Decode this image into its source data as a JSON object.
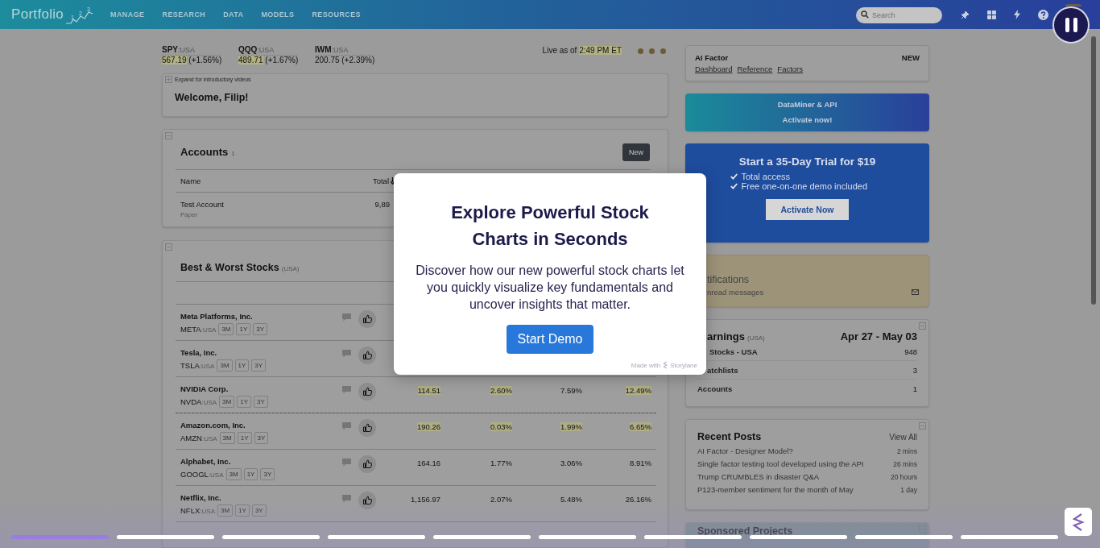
{
  "header": {
    "logo": "Portfolio",
    "logo_steps": [
      "1",
      "2",
      "3"
    ],
    "nav": [
      "MANAGE",
      "RESEARCH",
      "DATA",
      "MODELS",
      "RESOURCES"
    ],
    "search": {
      "placeholder": "Search"
    }
  },
  "market": {
    "tickers": [
      {
        "symbol": "SPY",
        "exchange": ":USA",
        "price": "567.19",
        "change": "(+1.56%)",
        "highlighted": true
      },
      {
        "symbol": "QQQ",
        "exchange": ":USA",
        "price": "489.71",
        "change": "(+1.67%)",
        "highlighted": true
      },
      {
        "symbol": "IWM",
        "exchange": ":USA",
        "price": "200.75",
        "change": "(+2.39%)",
        "highlighted": false
      }
    ],
    "live_label": "Live as of",
    "live_time": "2:49 PM ET"
  },
  "welcome": {
    "expand_label": "Expand for introductory videos",
    "greeting": "Welcome, Filip!"
  },
  "accounts": {
    "title": "Accounts",
    "count": "1",
    "new_button": "New",
    "columns": [
      "Name",
      "Total"
    ],
    "rows": [
      {
        "name": "Test Account",
        "type": "Paper",
        "total": "9,89"
      }
    ]
  },
  "stocks": {
    "title": "Best & Worst Stocks",
    "region": "(USA)",
    "rows": [
      {
        "name": "Meta Platforms, Inc.",
        "ticker": "META",
        "exchange": ":USA",
        "periods": [
          "3M",
          "1Y",
          "3Y"
        ],
        "values": [],
        "dashed_divider_above": false
      },
      {
        "name": "Tesla, Inc.",
        "ticker": "TSLA",
        "exchange": ":USA",
        "periods": [
          "3M",
          "1Y",
          "3Y"
        ],
        "values": [],
        "dashed_divider_above": false
      },
      {
        "name": "NVIDIA Corp.",
        "ticker": "NVDA",
        "exchange": ":USA",
        "periods": [
          "3M",
          "1Y",
          "3Y"
        ],
        "values": [
          {
            "text": "114.51",
            "highlighted": true
          },
          {
            "text": "2.60%",
            "highlighted": true
          },
          {
            "text": "7.59%",
            "highlighted": false
          },
          {
            "text": "12.49%",
            "highlighted": true
          }
        ],
        "dashed_divider_above": false
      },
      {
        "name": "Amazon.com, Inc.",
        "ticker": "AMZN",
        "exchange": ":USA",
        "periods": [
          "3M",
          "1Y",
          "3Y"
        ],
        "values": [
          {
            "text": "190.26",
            "highlighted": true
          },
          {
            "text": "0.03%",
            "highlighted": true
          },
          {
            "text": "1.99%",
            "highlighted": true
          },
          {
            "text": "6.65%",
            "highlighted": true
          }
        ],
        "dashed_divider_above": true
      },
      {
        "name": "Alphabet, Inc.",
        "ticker": "GOOGL",
        "exchange": ":USA",
        "periods": [
          "3M",
          "1Y",
          "3Y"
        ],
        "values": [
          {
            "text": "164.16",
            "highlighted": false
          },
          {
            "text": "1.77%",
            "highlighted": false
          },
          {
            "text": "3.06%",
            "highlighted": false
          },
          {
            "text": "8.91%",
            "highlighted": false
          }
        ],
        "dashed_divider_above": false
      },
      {
        "name": "Netflix, Inc.",
        "ticker": "NFLX",
        "exchange": ":USA",
        "periods": [
          "3M",
          "1Y",
          "3Y"
        ],
        "values": [
          {
            "text": "1,156.97",
            "highlighted": false
          },
          {
            "text": "2.07%",
            "highlighted": false
          },
          {
            "text": "5.48%",
            "highlighted": false
          },
          {
            "text": "26.16%",
            "highlighted": false
          }
        ],
        "dashed_divider_above": false
      }
    ]
  },
  "ai_factor": {
    "title": "AI Factor",
    "badge": "NEW",
    "links": [
      "Dashboard",
      "Reference",
      "Factors"
    ]
  },
  "dataminer": {
    "title": "DataMiner & API",
    "action": "Activate now!"
  },
  "trial": {
    "title": "Start a 35-Day Trial for $19",
    "features": [
      "Total access",
      "Free one-on-one demo included"
    ],
    "button": "Activate Now"
  },
  "notifications": {
    "title": "tifications",
    "subtitle": "nread messages"
  },
  "earnings": {
    "title": "arnings",
    "region": "(USA)",
    "range": "Apr 27 - May 03",
    "rows": [
      {
        "label": "Stocks - USA",
        "count": "948"
      },
      {
        "label": "atchlists",
        "count": "3"
      },
      {
        "label": "Accounts",
        "count": "1"
      }
    ]
  },
  "recent_posts": {
    "title": "Recent Posts",
    "view_all": "View All",
    "posts": [
      {
        "title": "AI Factor - Designer Model?",
        "age": "2 mins"
      },
      {
        "title": "Single factor testing tool developed using the API",
        "age": "26 mins"
      },
      {
        "title": "Trump CRUMBLES in disaster Q&A",
        "age": "20 hours"
      },
      {
        "title": "P123-member sentiment for the month of May",
        "age": "1 day"
      }
    ]
  },
  "sponsored": {
    "title": "Sponsored Projects"
  },
  "modal": {
    "title": "Explore Powerful Stock Charts in Seconds",
    "body": "Discover how our new powerful stock charts let you quickly visualize key fundamentals and uncover insights that matter.",
    "button": "Start Demo",
    "credit": "Made with",
    "brand": "Storylane"
  },
  "story": {
    "steps": [
      {
        "selected": true
      },
      {
        "selected": false
      },
      {
        "selected": false
      },
      {
        "selected": false
      },
      {
        "selected": false
      },
      {
        "selected": false
      },
      {
        "selected": false
      },
      {
        "selected": false
      },
      {
        "selected": false
      },
      {
        "selected": false
      }
    ]
  }
}
